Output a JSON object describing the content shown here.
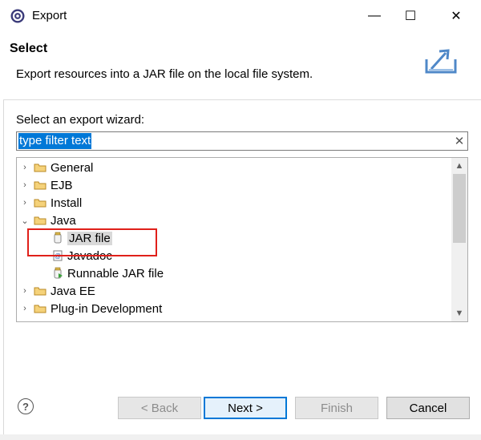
{
  "window": {
    "title": "Export",
    "app_icon": "eclipse-gear-icon",
    "controls": {
      "minimize": "—",
      "maximize": "☐",
      "close": "✕"
    }
  },
  "banner": {
    "title": "Select",
    "description": "Export resources into a JAR file on the local file system.",
    "icon": "export-wizard-icon"
  },
  "wizard": {
    "label": "Select an export wizard:",
    "filter": {
      "value": "type filter text",
      "clear_icon": "✕"
    },
    "tree": [
      {
        "label": "General",
        "expanded": false,
        "icon": "folder-icon"
      },
      {
        "label": "EJB",
        "expanded": false,
        "icon": "folder-icon"
      },
      {
        "label": "Install",
        "expanded": false,
        "icon": "folder-icon"
      },
      {
        "label": "Java",
        "expanded": true,
        "icon": "folder-icon"
      },
      {
        "label": "JAR file",
        "child": true,
        "selected": true,
        "icon": "jar-icon"
      },
      {
        "label": "Javadoc",
        "child": true,
        "icon": "javadoc-icon"
      },
      {
        "label": "Runnable JAR file",
        "child": true,
        "icon": "runnable-jar-icon"
      },
      {
        "label": "Java EE",
        "expanded": false,
        "icon": "folder-icon"
      },
      {
        "label": "Plug-in Development",
        "expanded": false,
        "icon": "folder-icon"
      }
    ],
    "twisty": {
      "collapsed": "›",
      "expanded": "⌄"
    }
  },
  "footer": {
    "help": "?",
    "back": "< Back",
    "next": "Next >",
    "finish": "Finish",
    "cancel": "Cancel"
  },
  "colors": {
    "selection": "#0078d7",
    "highlight_box": "#e0201a",
    "folder": "#e8b64c"
  }
}
